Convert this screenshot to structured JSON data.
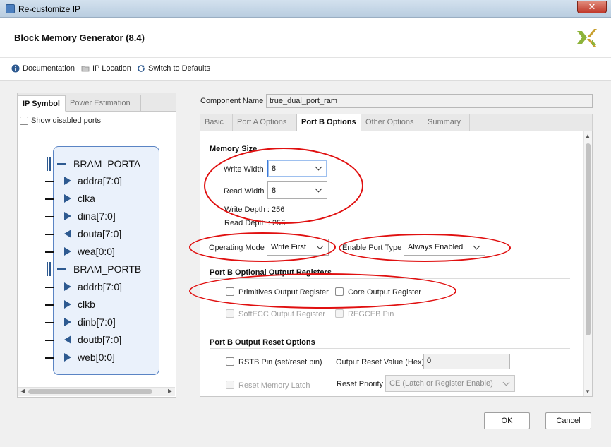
{
  "window": {
    "title": "Re-customize IP",
    "close_label": "✕"
  },
  "header": {
    "title": "Block Memory Generator (8.4)"
  },
  "toolbar": {
    "documentation": "Documentation",
    "ip_location": "IP Location",
    "switch_defaults": "Switch to Defaults"
  },
  "left_panel": {
    "tabs": [
      "IP Symbol",
      "Power Estimation"
    ],
    "show_disabled_ports": "Show disabled ports",
    "port_a": {
      "name": "BRAM_PORTA",
      "ports": [
        {
          "name": "addra[7:0]",
          "dir": "in"
        },
        {
          "name": "clka",
          "dir": "in"
        },
        {
          "name": "dina[7:0]",
          "dir": "in"
        },
        {
          "name": "douta[7:0]",
          "dir": "out"
        },
        {
          "name": "wea[0:0]",
          "dir": "in"
        }
      ]
    },
    "port_b": {
      "name": "BRAM_PORTB",
      "ports": [
        {
          "name": "addrb[7:0]",
          "dir": "in"
        },
        {
          "name": "clkb",
          "dir": "in"
        },
        {
          "name": "dinb[7:0]",
          "dir": "in"
        },
        {
          "name": "doutb[7:0]",
          "dir": "out"
        },
        {
          "name": "web[0:0]",
          "dir": "in"
        }
      ]
    }
  },
  "component": {
    "label": "Component Name",
    "value": "true_dual_port_ram"
  },
  "tabs": [
    "Basic",
    "Port A Options",
    "Port B Options",
    "Other Options",
    "Summary"
  ],
  "memory_size": {
    "title": "Memory Size",
    "write_width_label": "Write Width",
    "write_width": "8",
    "read_width_label": "Read Width",
    "read_width": "8",
    "write_depth": "Write Depth : 256",
    "read_depth": "Read Depth : 256"
  },
  "operating": {
    "mode_label": "Operating Mode",
    "mode_value": "Write First",
    "enable_label": "Enable Port Type",
    "enable_value": "Always Enabled"
  },
  "output_registers": {
    "title": "Port B Optional Output Registers",
    "primitives": "Primitives Output Register",
    "core": "Core Output Register",
    "softecc": "SoftECC Output Register",
    "regceb": "REGCEB Pin"
  },
  "reset_options": {
    "title": "Port B Output Reset Options",
    "rstb": "RSTB Pin (set/reset pin)",
    "reset_value_label": "Output Reset Value (Hex)",
    "reset_value": "0",
    "reset_latch": "Reset Memory Latch",
    "priority_label": "Reset Priority",
    "priority_value": "CE (Latch or Register Enable)"
  },
  "footer": {
    "ok": "OK",
    "cancel": "Cancel"
  },
  "colors": {
    "accent": "#2e5a90",
    "annotation": "#e01010",
    "logo": "#8db33a"
  }
}
